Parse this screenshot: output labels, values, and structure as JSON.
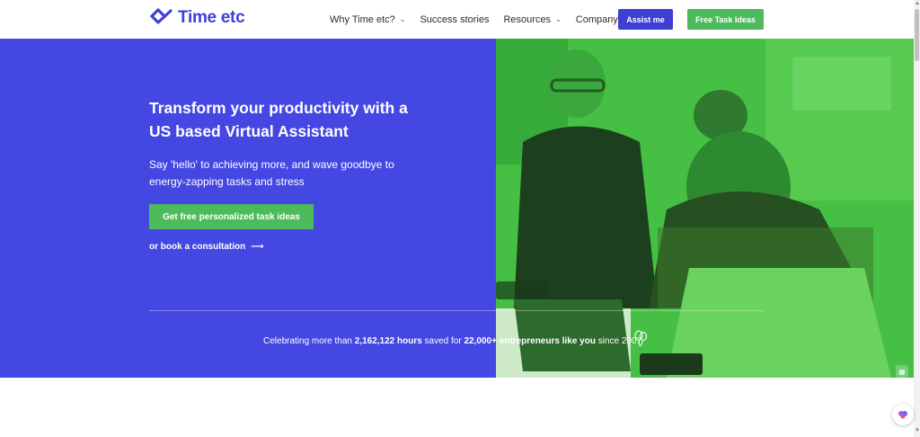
{
  "nav": {
    "logo_text": "Time etc",
    "menu": [
      {
        "label": "Why Time etc?",
        "dropdown": true
      },
      {
        "label": "Success stories",
        "dropdown": false
      },
      {
        "label": "Resources",
        "dropdown": true
      },
      {
        "label": "Company",
        "dropdown": true
      }
    ],
    "assist_label": "Assist me",
    "free_label": "Free Task Ideas"
  },
  "hero": {
    "title": "Transform your productivity with a US based Virtual Assistant",
    "subtitle": "Say 'hello' to achieving more, and wave goodbye to energy-zapping tasks and stress",
    "cta_label": "Get free personalized task ideas",
    "link_label": "or book a consultation",
    "link_arrow": "⟶",
    "stats": {
      "prefix": "Celebrating more than ",
      "hours": "2,162,122 hours",
      "middle": " saved for ",
      "entrepreneurs": "22,000+ entrepreneurs like you",
      "suffix": " since 2007"
    }
  },
  "colors": {
    "brand": "#3f3fd6",
    "hero_bg": "#4447e2",
    "accent_green": "#4dbb5b"
  },
  "icons": {
    "logo": "check-heart-icon",
    "chevron": "chevron-down-icon",
    "balloon": "balloon-icon",
    "widget": "brain-icon"
  }
}
